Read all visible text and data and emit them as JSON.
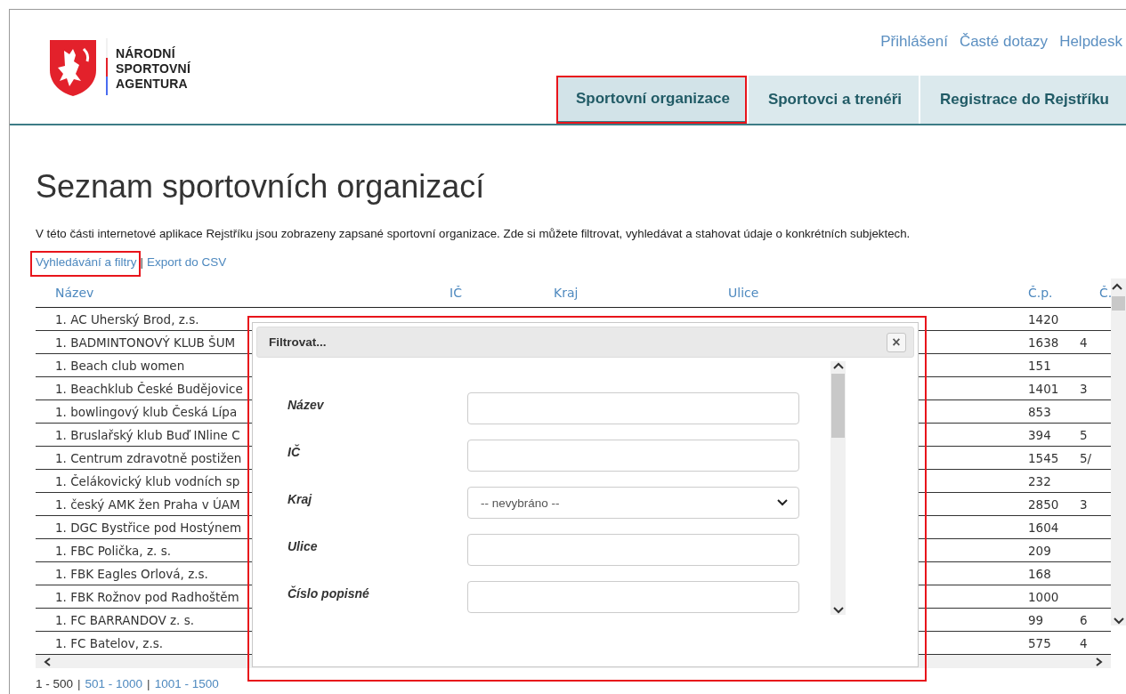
{
  "logo": {
    "lines": [
      "NÁRODNÍ",
      "SPORTOVNÍ",
      "AGENTURA"
    ]
  },
  "top_links": [
    "Přihlášení",
    "Časté dotazy",
    "Helpdesk"
  ],
  "tabs": [
    {
      "label": "Sportovní organizace",
      "selected": true,
      "highlighted": true
    },
    {
      "label": "Sportovci a trenéři",
      "selected": false,
      "highlighted": false
    },
    {
      "label": "Registrace do Rejstříku",
      "selected": false,
      "highlighted": false
    }
  ],
  "title": "Seznam sportovních organizací",
  "description": "V této části internetové aplikace Rejstříku jsou zobrazeny zapsané sportovní organizace. Zde si můžete filtrovat, vyhledávat a stahovat údaje o konkrétních subjektech.",
  "actions": [
    {
      "label": "Vyhledávání a filtry",
      "highlighted": true
    },
    {
      "label": "Export do CSV",
      "highlighted": false
    }
  ],
  "action_separator": "|",
  "table": {
    "columns": [
      "Název",
      "IČ",
      "Kraj",
      "Ulice",
      "Č.p.",
      "Č."
    ],
    "rows": [
      [
        "1. AC Uherský Brod, z.s.",
        "1420",
        ""
      ],
      [
        "1. BADMINTONOVÝ KLUB ŠUM",
        "1638",
        "4"
      ],
      [
        "1. Beach club women",
        "151",
        ""
      ],
      [
        "1. Beachklub České Budějovice",
        "1401",
        "3"
      ],
      [
        "1. bowlingový klub Česká Lípa",
        "853",
        ""
      ],
      [
        "1. Bruslařský klub Buď INline C",
        "394",
        "5"
      ],
      [
        "1. Centrum zdravotně postižen",
        "1545",
        "5/"
      ],
      [
        "1. Čelákovický klub vodních sp",
        "232",
        ""
      ],
      [
        "1. český AMK žen Praha v ÚAM",
        "2850",
        "3"
      ],
      [
        "1. DGC Bystřice pod Hostýnem",
        "1604",
        ""
      ],
      [
        "1. FBC Polička, z. s.",
        "209",
        ""
      ],
      [
        "1. FBK Eagles Orlová, z.s.",
        "168",
        ""
      ],
      [
        "1. FBK Rožnov pod Radhoštěm",
        "1000",
        ""
      ],
      [
        "1. FC BARRANDOV z. s.",
        "99",
        "6"
      ],
      [
        "1. FC Batelov, z.s.",
        "575",
        "4"
      ]
    ]
  },
  "pagination": [
    {
      "label": "1 - 500",
      "selected": true
    },
    {
      "label": "501 - 1000",
      "selected": false
    },
    {
      "label": "1001 - 1500",
      "selected": false
    }
  ],
  "pagination_separator": "|",
  "dialog": {
    "title": "Filtrovat...",
    "highlighted": true,
    "close": "×",
    "fields": [
      {
        "label": "Název",
        "kind": "text"
      },
      {
        "label": "IČ",
        "kind": "text"
      },
      {
        "label": "Kraj",
        "kind": "select",
        "value": "-- nevybráno --"
      },
      {
        "label": "Ulice",
        "kind": "text"
      },
      {
        "label": "Číslo popisné",
        "kind": "text"
      }
    ]
  }
}
